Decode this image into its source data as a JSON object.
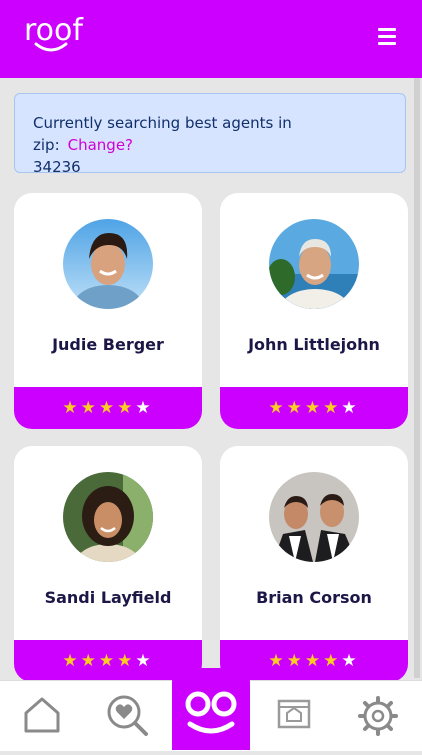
{
  "header": {
    "logo_text": "roof",
    "menu_icon": "hamburger-menu-icon"
  },
  "notice": {
    "text": "Currently searching best agents in zip:",
    "change_label": "Change?",
    "zip": "34236"
  },
  "agents": [
    {
      "name": "Judie Berger",
      "rating": 4,
      "max_rating": 5
    },
    {
      "name": "John Littlejohn",
      "rating": 4,
      "max_rating": 5
    },
    {
      "name": "Sandi Layfield",
      "rating": 4,
      "max_rating": 5
    },
    {
      "name": "Brian Corson",
      "rating": 4,
      "max_rating": 5
    }
  ],
  "colors": {
    "brand": "#cc00ff",
    "star": "#ffcc22",
    "notice_bg": "#d6e4ff",
    "name_text": "#1c1747"
  },
  "bottom_nav": {
    "items": [
      "home-icon",
      "search-heart-icon",
      "roof-face-icon",
      "listing-icon",
      "settings-gear-icon"
    ]
  }
}
